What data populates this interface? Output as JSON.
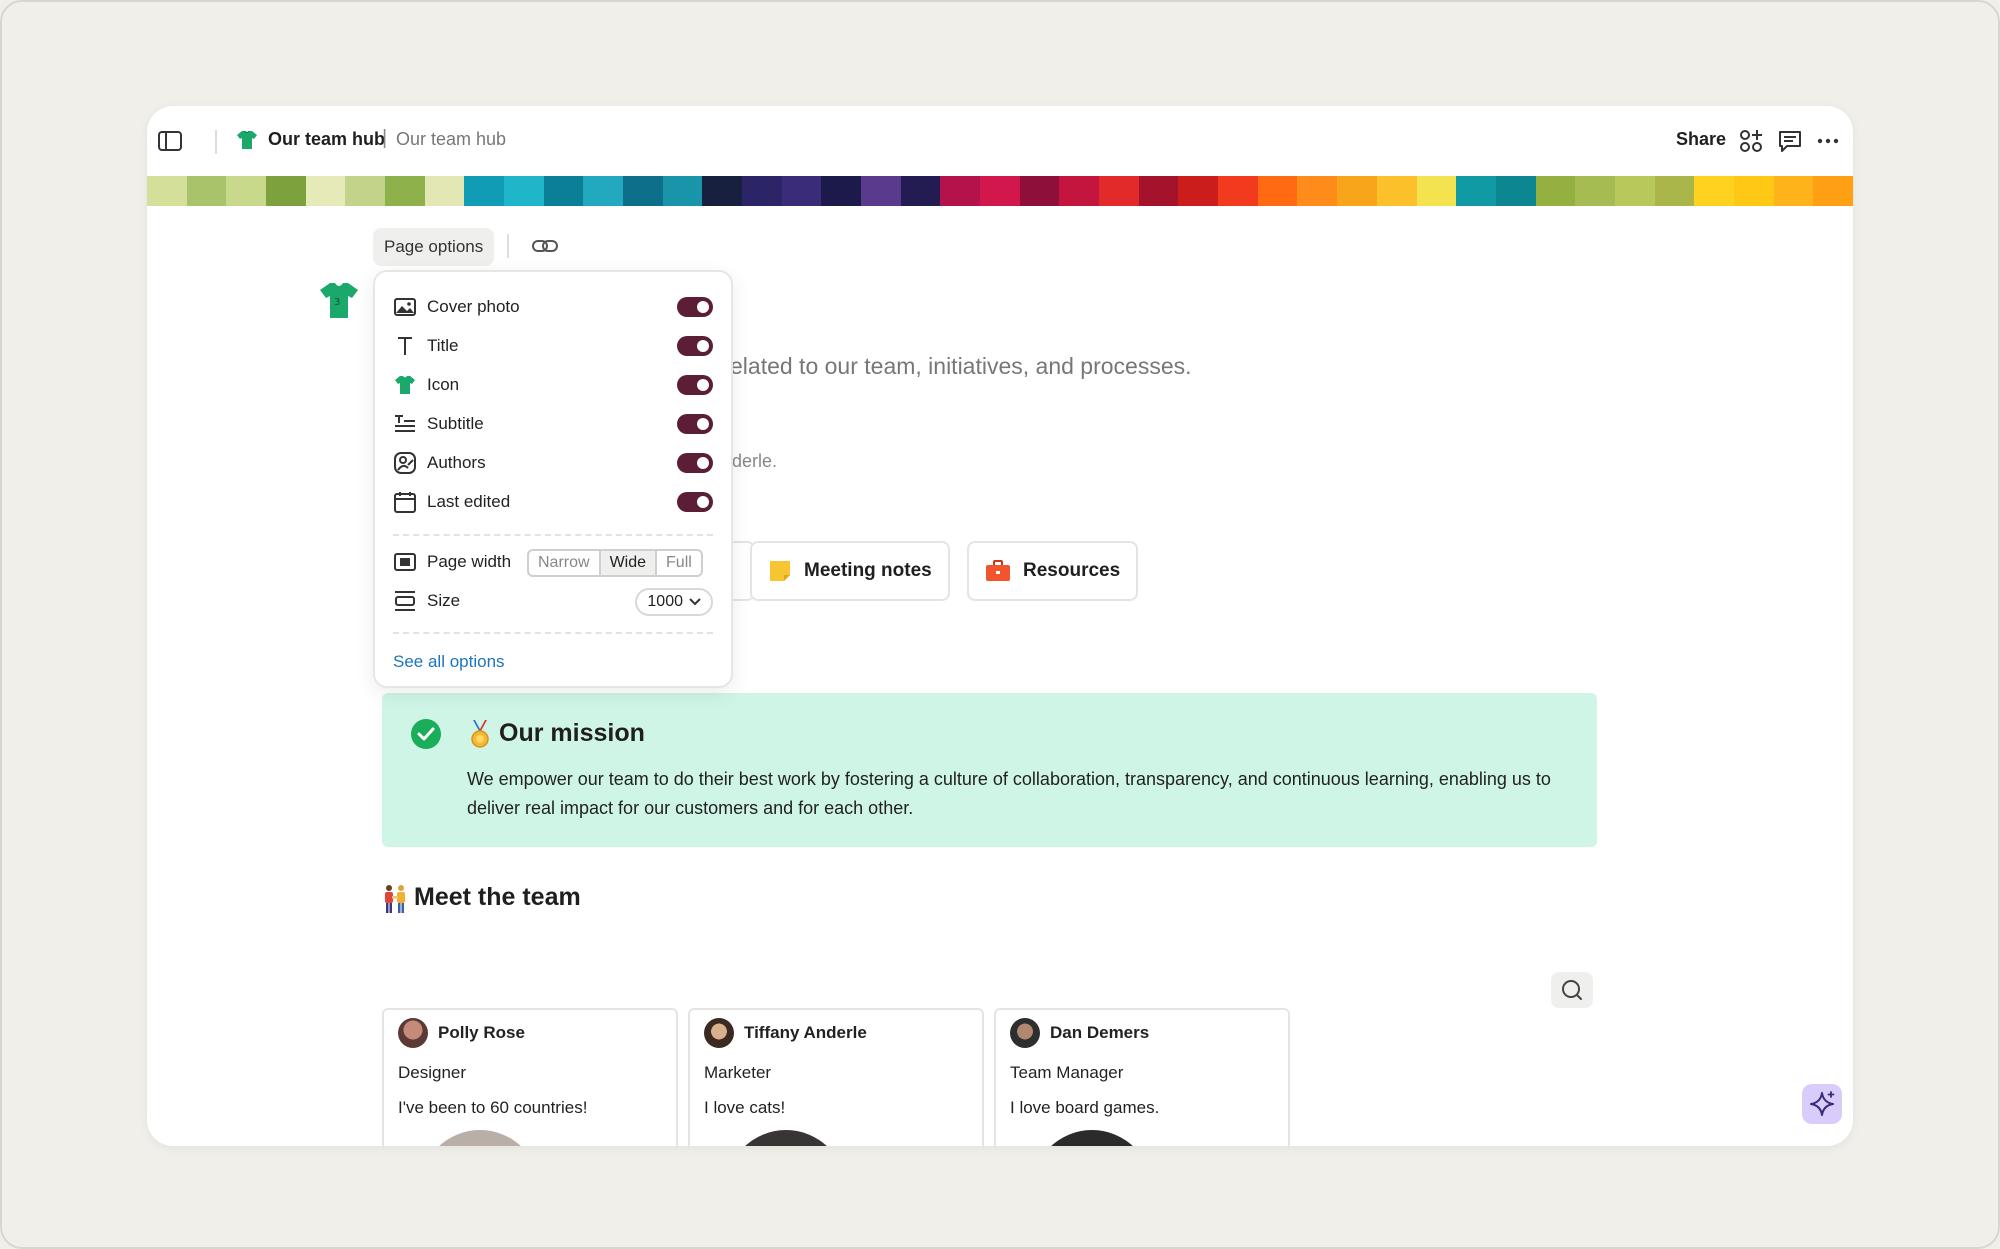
{
  "breadcrumb": {
    "title": "Our team hub",
    "separator": "|",
    "current": "Our team hub"
  },
  "header": {
    "share_label": "Share"
  },
  "cover": {
    "stripe_colors": [
      "#d4df9a",
      "#a9c36a",
      "#c8d98c",
      "#7da23d",
      "#e6eab8",
      "#c3d48a",
      "#8fb14c",
      "#e2e7b4",
      "#0f9cb4",
      "#1fb6c9",
      "#0b7f96",
      "#22a9c0",
      "#0d6f8a",
      "#1a94a8",
      "#17203f",
      "#2b2466",
      "#3b2c7a",
      "#1b1a4a",
      "#5a3a8c",
      "#231c52",
      "#b3124a",
      "#d2174d",
      "#8e0f3a",
      "#c4153f",
      "#e22a2a",
      "#a5122c",
      "#cc1d1d",
      "#f23a1e",
      "#ff6a13",
      "#ff8b1a",
      "#f9a51c",
      "#fbc02a",
      "#f2e34f",
      "#0f9aa4",
      "#0c8691",
      "#93b040",
      "#a4bc52",
      "#b9c85a",
      "#aab64a",
      "#ffd21f",
      "#ffc814",
      "#ffb31a",
      "#ff9f14"
    ]
  },
  "page_options": {
    "button_label": "Page options",
    "toggles": [
      {
        "label": "Cover photo",
        "on": true
      },
      {
        "label": "Title",
        "on": true
      },
      {
        "label": "Icon",
        "on": true
      },
      {
        "label": "Subtitle",
        "on": true
      },
      {
        "label": "Authors",
        "on": true
      },
      {
        "label": "Last edited",
        "on": true
      }
    ],
    "page_width": {
      "label": "Page width",
      "options": [
        "Narrow",
        "Wide",
        "Full"
      ],
      "selected": "Wide"
    },
    "size": {
      "label": "Size",
      "value": "1000"
    },
    "see_all": "See all options"
  },
  "page": {
    "subtitle_fragment": "elated to our team, initiatives, and processes.",
    "authors_fragment": "derle.",
    "chips": [
      {
        "label": "Meeting notes",
        "color": "#f7c531"
      },
      {
        "label": "Resources",
        "color": "#f0552e"
      }
    ]
  },
  "mission": {
    "title": "Our mission",
    "text": "We empower our team to do their best work by fostering a culture of collaboration, transparency, and continuous learning, enabling us to deliver real impact for our customers and for each other.",
    "bg_color": "#cff5e7"
  },
  "team": {
    "title": "Meet the team",
    "members": [
      {
        "name": "Polly Rose",
        "role": "Designer",
        "fact": "I've been to 60 countries!"
      },
      {
        "name": "Tiffany Anderle",
        "role": "Marketer",
        "fact": "I love cats!"
      },
      {
        "name": "Dan Demers",
        "role": "Team Manager",
        "fact": "I love board games."
      }
    ]
  },
  "colors": {
    "accent_toggle": "#5b1e36",
    "link": "#1b76bd",
    "ai_button": "#d9ccfb"
  }
}
